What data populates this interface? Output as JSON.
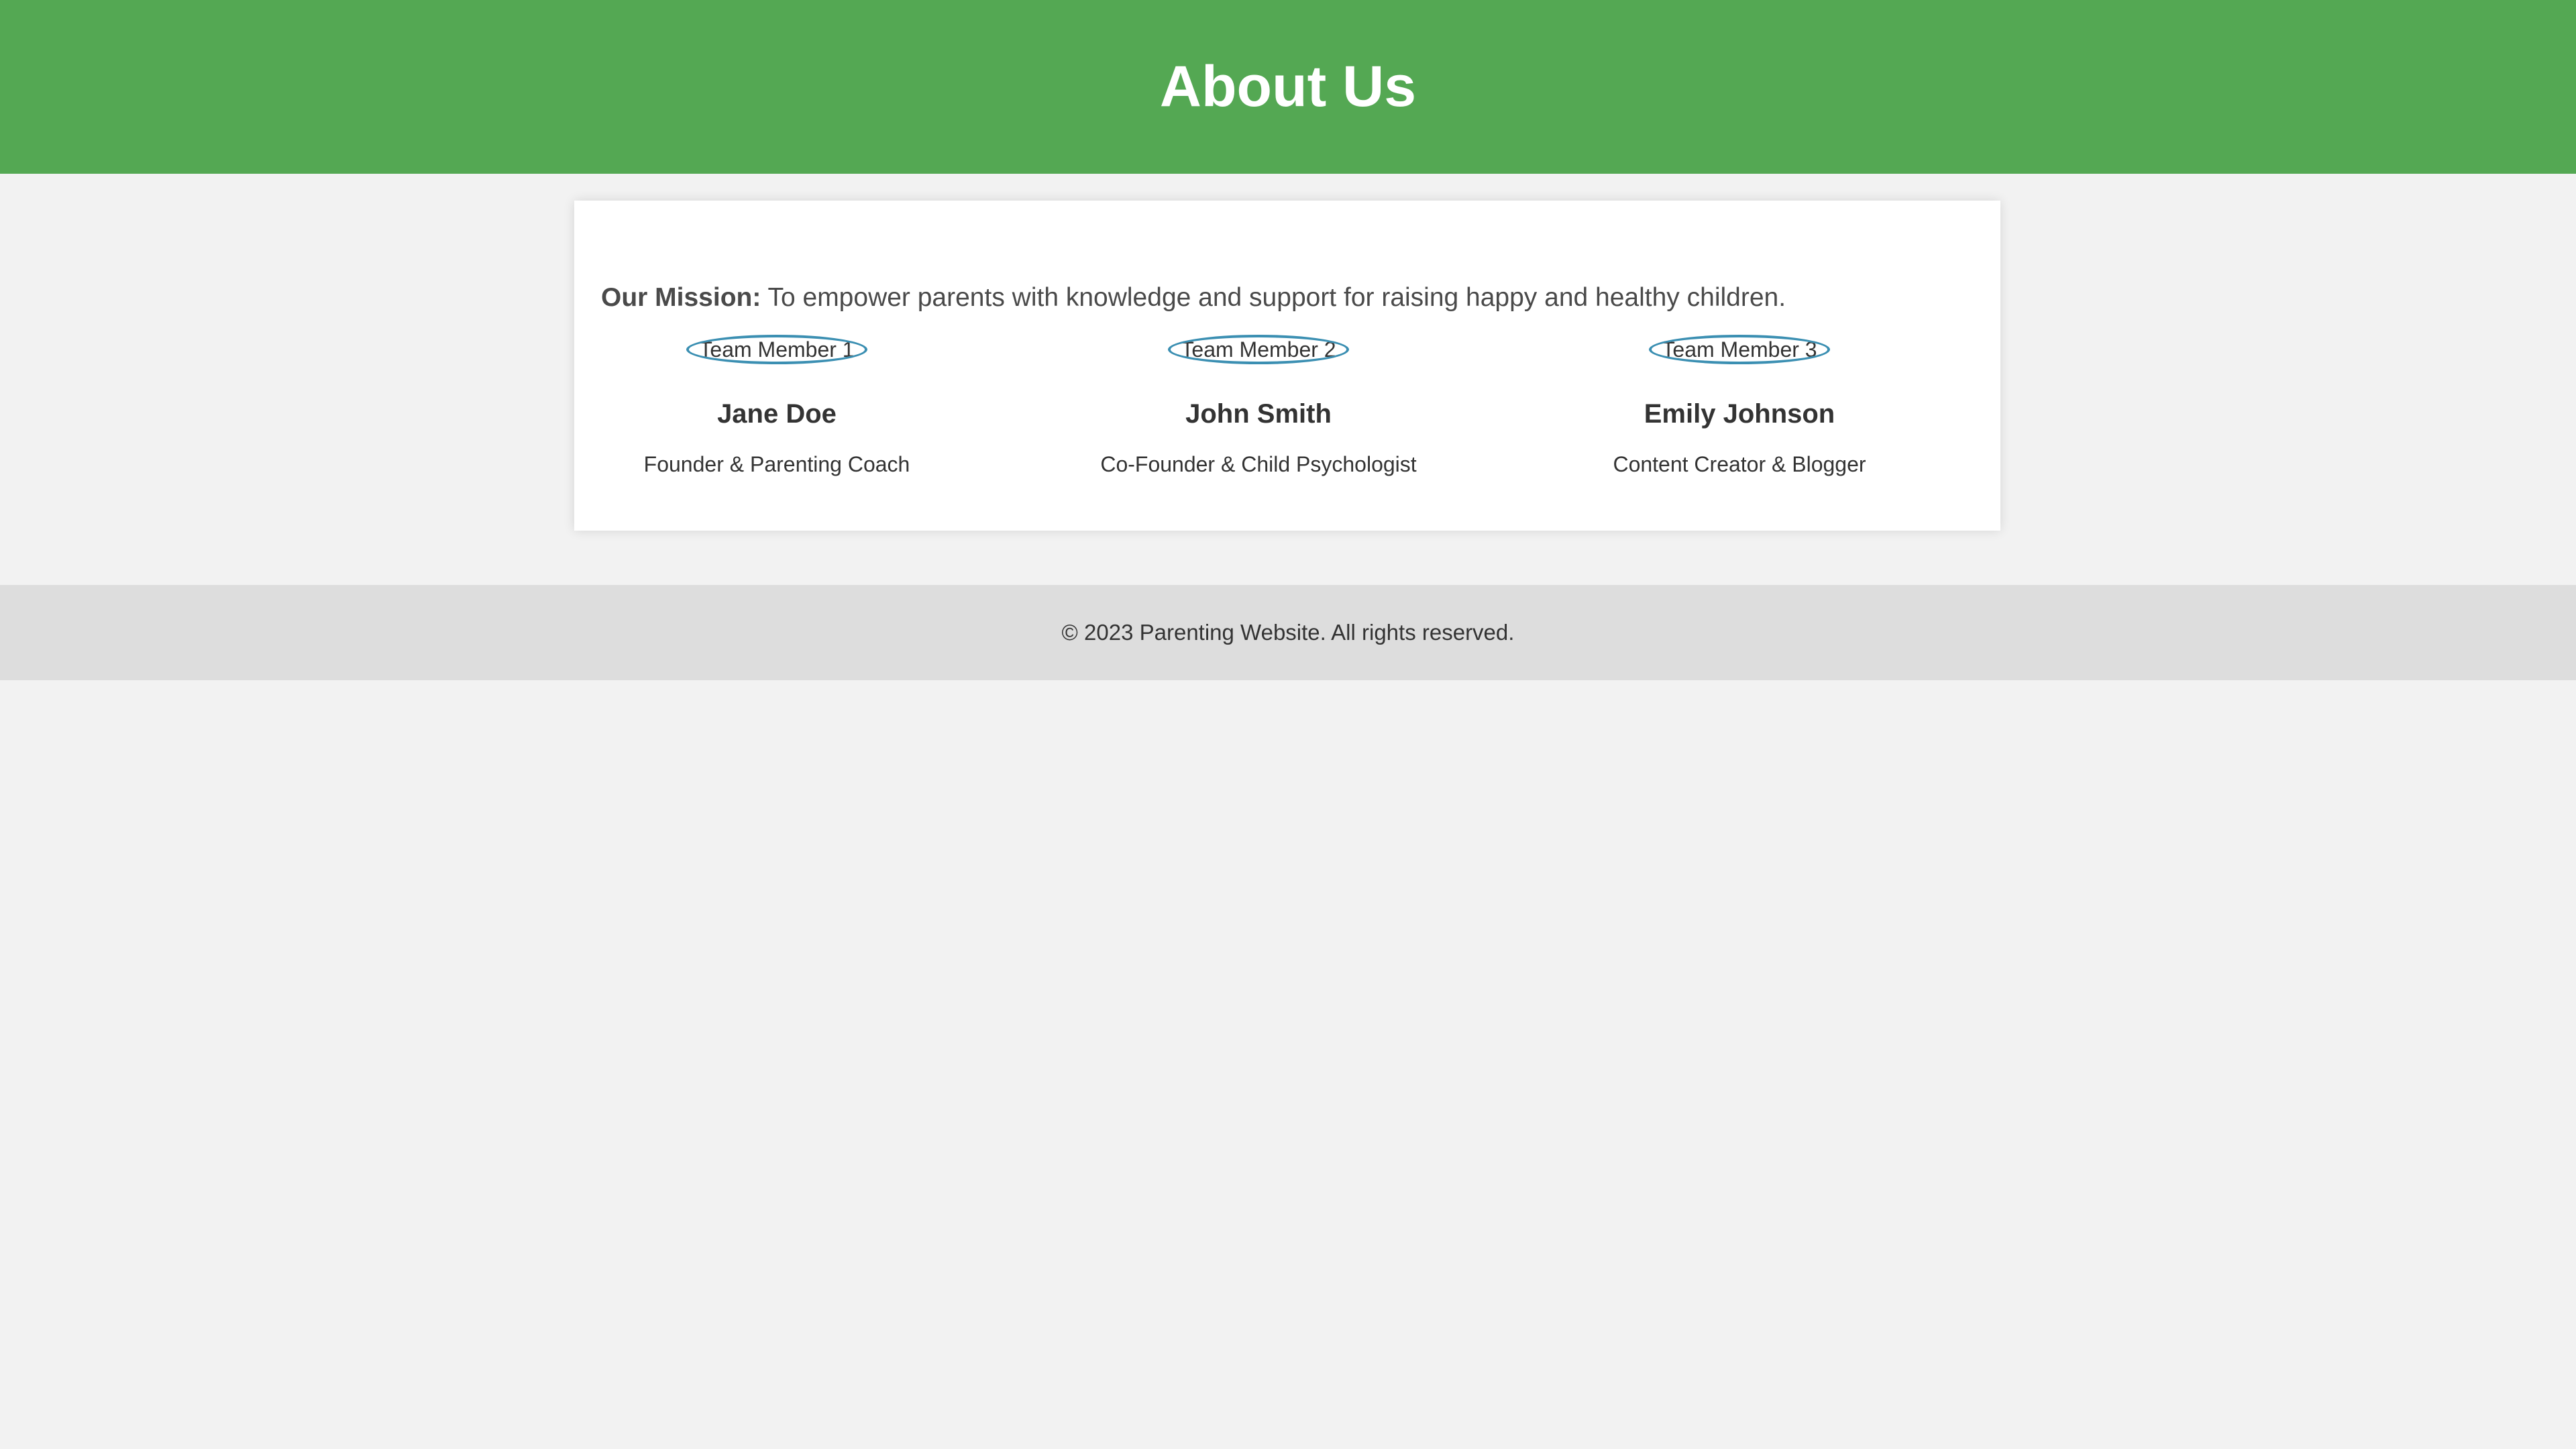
{
  "header": {
    "title": "About Us",
    "background_color": "#54a853"
  },
  "mission": {
    "label": "Our Mission:",
    "text": "To empower parents with knowledge and support for raising happy and healthy children."
  },
  "team": [
    {
      "image_alt": "Team Member 1",
      "name": "Jane Doe",
      "role": "Founder & Parenting Coach"
    },
    {
      "image_alt": "Team Member 2",
      "name": "John Smith",
      "role": "Co-Founder & Child Psychologist"
    },
    {
      "image_alt": "Team Member 3",
      "name": "Emily Johnson",
      "role": "Content Creator & Blogger"
    }
  ],
  "footer": {
    "text": "© 2023 Parenting Website. All rights reserved."
  }
}
